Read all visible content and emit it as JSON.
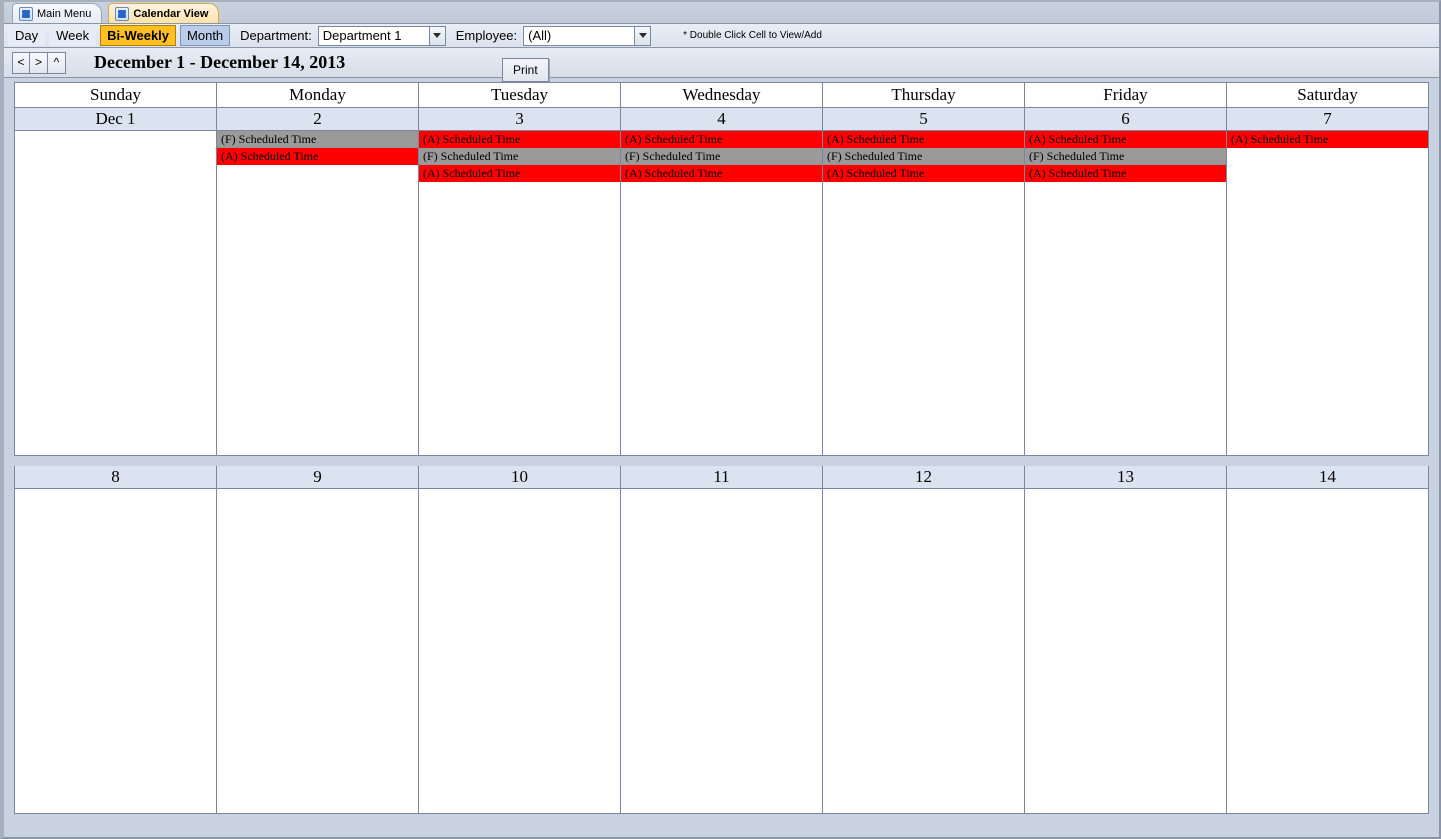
{
  "tabs": [
    {
      "label": "Main Menu",
      "active": false
    },
    {
      "label": "Calendar View",
      "active": true
    }
  ],
  "toolbar": {
    "views": {
      "day": "Day",
      "week": "Week",
      "biweekly": "Bi-Weekly",
      "month": "Month",
      "active": "biweekly"
    },
    "department_label": "Department:",
    "department_value": "Department 1",
    "employee_label": "Employee:",
    "employee_value": "(All)",
    "hint": "* Double Click Cell to View/Add"
  },
  "nav": {
    "prev": "<",
    "next": ">",
    "up": "^",
    "range_title": "December 1 - December 14, 2013",
    "print": "Print"
  },
  "days_of_week": [
    "Sunday",
    "Monday",
    "Tuesday",
    "Wednesday",
    "Thursday",
    "Friday",
    "Saturday"
  ],
  "weeks": [
    {
      "dates": [
        "Dec 1",
        "2",
        "3",
        "4",
        "5",
        "6",
        "7"
      ],
      "events": [
        [],
        [
          {
            "text": "(F) Scheduled Time",
            "color": "grey"
          },
          {
            "text": "(A) Scheduled Time",
            "color": "red"
          }
        ],
        [
          {
            "text": "(A) Scheduled Time",
            "color": "red"
          },
          {
            "text": "(F) Scheduled Time",
            "color": "grey"
          },
          {
            "text": "(A) Scheduled Time",
            "color": "red"
          }
        ],
        [
          {
            "text": "(A) Scheduled Time",
            "color": "red"
          },
          {
            "text": "(F) Scheduled Time",
            "color": "grey"
          },
          {
            "text": "(A) Scheduled Time",
            "color": "red"
          }
        ],
        [
          {
            "text": "(A) Scheduled Time",
            "color": "red"
          },
          {
            "text": "(F) Scheduled Time",
            "color": "grey"
          },
          {
            "text": "(A) Scheduled Time",
            "color": "red"
          }
        ],
        [
          {
            "text": "(A) Scheduled Time",
            "color": "red"
          },
          {
            "text": "(F) Scheduled Time",
            "color": "grey"
          },
          {
            "text": "(A) Scheduled Time",
            "color": "red"
          }
        ],
        [
          {
            "text": "(A) Scheduled Time",
            "color": "red"
          }
        ]
      ]
    },
    {
      "dates": [
        "8",
        "9",
        "10",
        "11",
        "12",
        "13",
        "14"
      ],
      "events": [
        [],
        [],
        [],
        [],
        [],
        [],
        []
      ]
    }
  ]
}
